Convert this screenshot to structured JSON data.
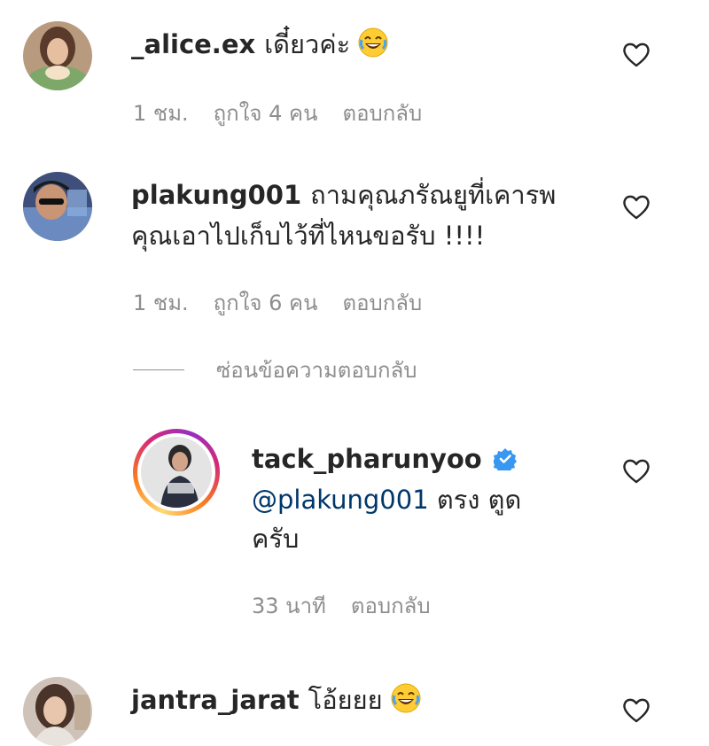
{
  "comments": [
    {
      "username": "_alice.ex",
      "text": "เดี๋ยวค่ะ",
      "time": "1 ชม.",
      "likes": "ถูกใจ 4 คน",
      "reply": "ตอบกลับ"
    },
    {
      "username": "plakung001",
      "text_line1": "ถามคุณภรัณยูที่เคารพ",
      "text_line2": "คุณเอาไปเก็บไว้ที่ไหนขอรับ !!!!",
      "time": "1 ชม.",
      "likes": "ถูกใจ 6 คน",
      "reply": "ตอบกลับ"
    }
  ],
  "hide_replies_label": "ซ่อนข้อความตอบกลับ",
  "reply_comment": {
    "username": "tack_pharunyoo",
    "mention": "@plakung001",
    "text_line1": "ตรง ตูด",
    "text_line2": "ครับ",
    "time": "33 นาที",
    "reply": "ตอบกลับ"
  },
  "last_comment": {
    "username": "jantra_jarat",
    "text": "โอ้ยยย"
  },
  "colors": {
    "mention": "#00376b",
    "meta": "#8e8e8e",
    "verified": "#3897f0"
  },
  "icons": [
    "heart-icon",
    "verified-badge-icon",
    "laughing-emoji"
  ]
}
